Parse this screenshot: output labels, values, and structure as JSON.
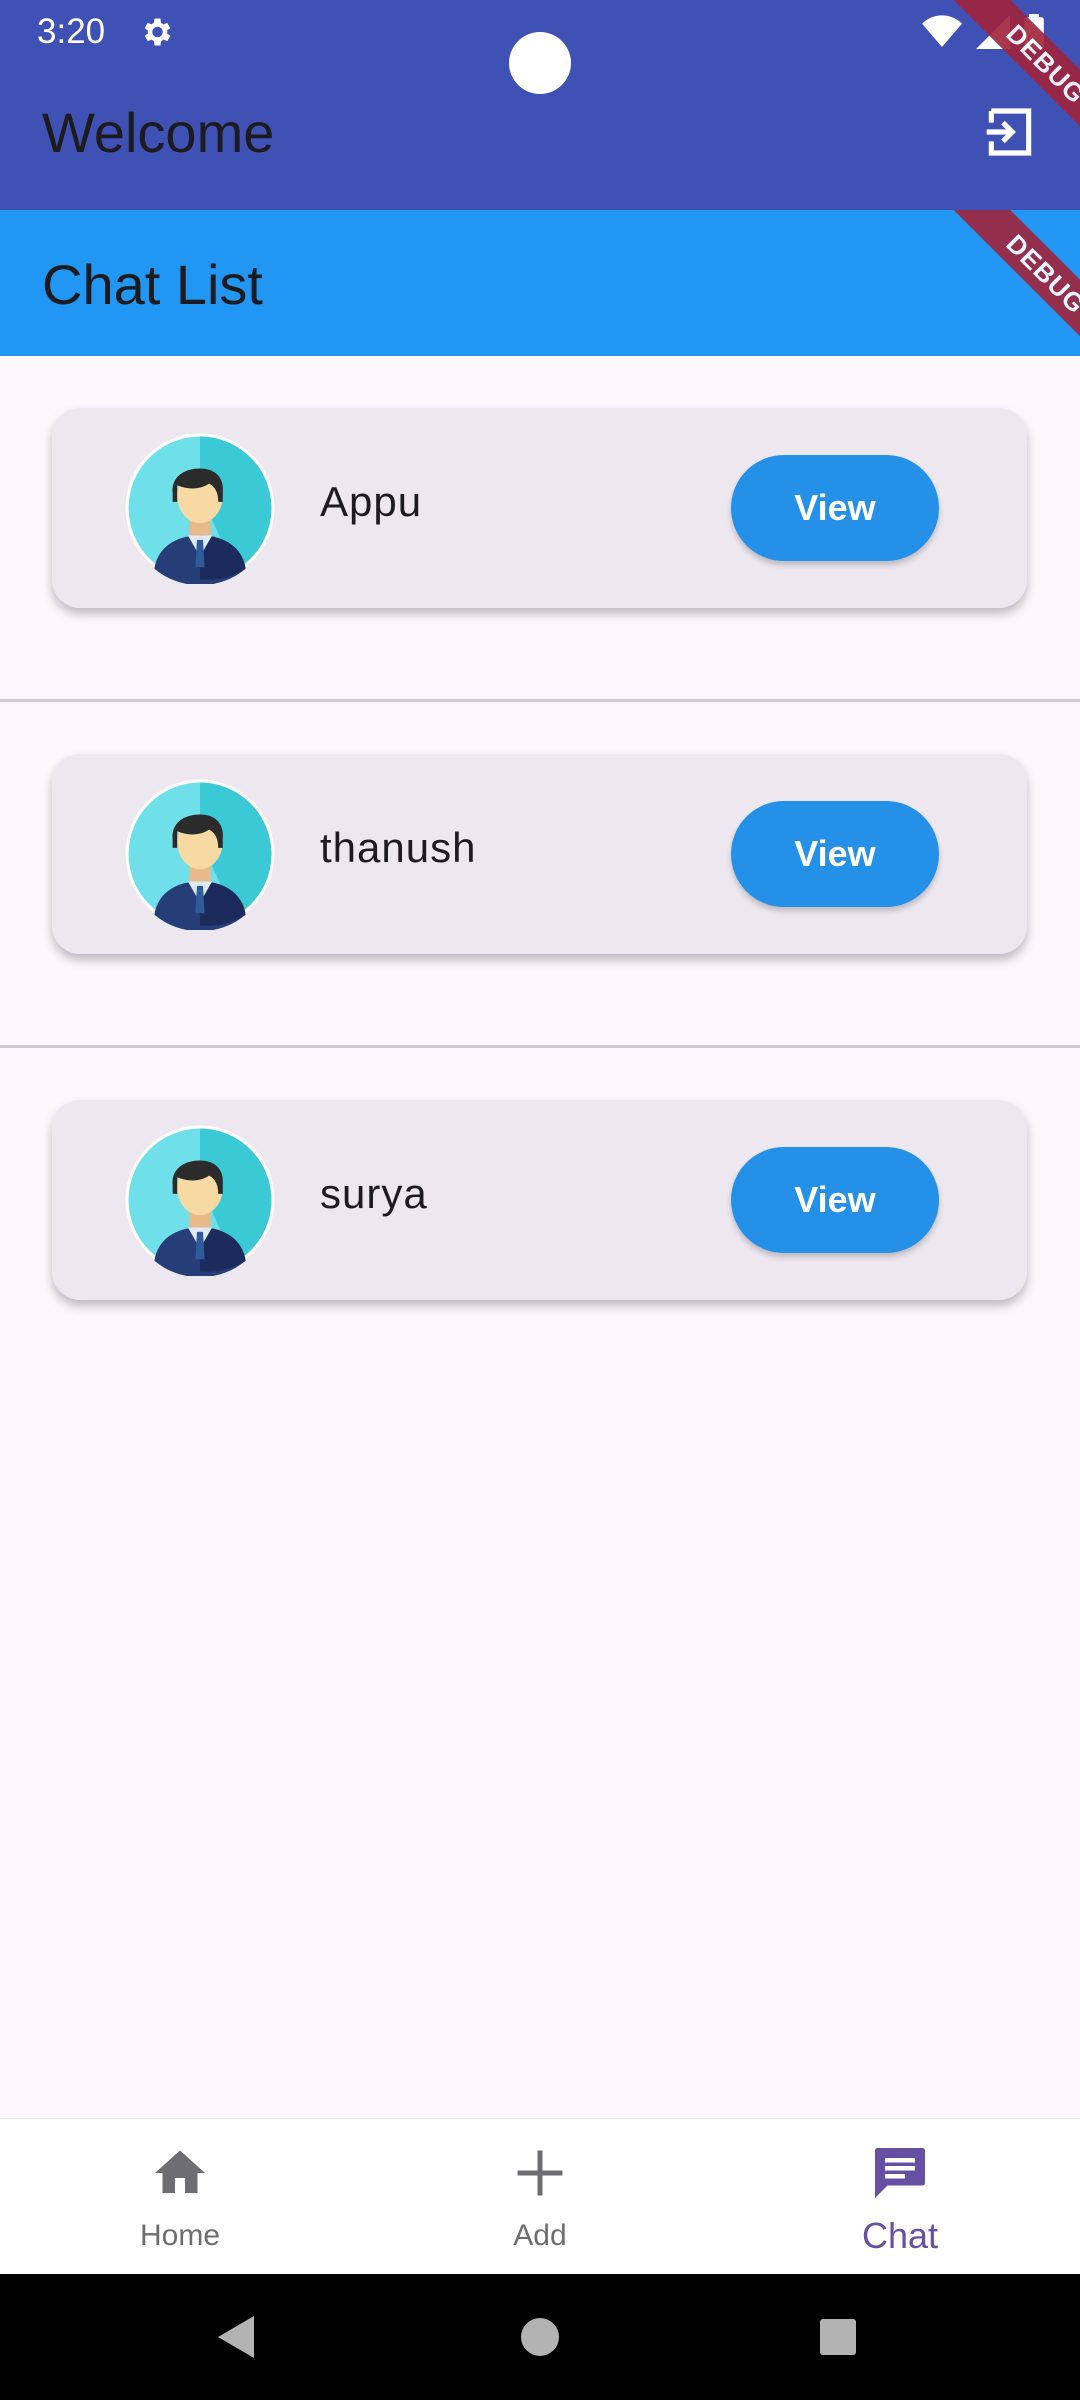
{
  "status_bar": {
    "time": "3:20",
    "debug_label": "DEBUG"
  },
  "app_bar": {
    "title": "Welcome",
    "action_icon": "logout-icon"
  },
  "sub_bar": {
    "title": "Chat List",
    "debug_label": "DEBUG"
  },
  "chats": [
    {
      "name": "Appu",
      "button": "View",
      "avatar": "person-avatar"
    },
    {
      "name": "thanush",
      "button": "View",
      "avatar": "person-avatar"
    },
    {
      "name": "surya",
      "button": "View",
      "avatar": "person-avatar"
    }
  ],
  "bottom_nav": {
    "items": [
      {
        "label": "Home",
        "icon": "home-icon",
        "active": false
      },
      {
        "label": "Add",
        "icon": "plus-icon",
        "active": false
      },
      {
        "label": "Chat",
        "icon": "chat-icon",
        "active": true
      }
    ]
  },
  "colors": {
    "app_bar": "#3f51b5",
    "sub_bar": "#2196f3",
    "card": "#ede8f0",
    "button": "#2590e8",
    "active_nav": "#6750a4",
    "background": "#fdf8fc"
  }
}
